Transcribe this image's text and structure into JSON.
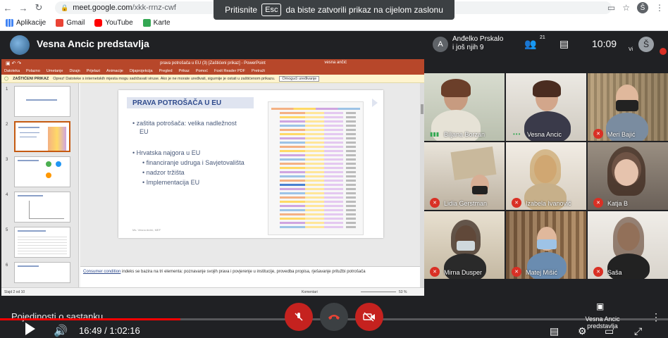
{
  "browser": {
    "url_host": "meet.google.com",
    "url_path": "/xkk-rrnz-cwf",
    "profile_initial": "Š",
    "bookmarks": [
      {
        "label": "Aplikacije",
        "color": "#4285f4"
      },
      {
        "label": "Gmail",
        "color": "#ea4335"
      },
      {
        "label": "YouTube",
        "color": "#ff0000"
      },
      {
        "label": "Karte",
        "color": "#34a853"
      }
    ]
  },
  "toast": {
    "before": "Pritisnite",
    "key": "Esc",
    "after": "da biste zatvorili prikaz na cijelom zaslonu"
  },
  "meet": {
    "presenter_title": "Vesna Ancic predstavlja",
    "people_line1": "Anđelko Prskalo",
    "people_line2": "i još njih 9",
    "people_avatar": "A",
    "people_count": "21",
    "clock": "10:09",
    "self_label": "Vi",
    "self_initial": "Š"
  },
  "ppt": {
    "window_title": "prava potrošača u EU (3) [Zaštićeni prikaz] - PowerPoint",
    "user_name": "vesna ančić",
    "menu": [
      "Datoteka",
      "Polazno",
      "Umetanje",
      "Dizajn",
      "Prijelazi",
      "Animacije",
      "Dijaprojekcija",
      "Pregled",
      "Prikaz",
      "Pomoć",
      "Foxit Reader PDF",
      "Pretraži"
    ],
    "warning_label": "ZAŠTIĆENI PRIKAZ",
    "warning_text": "Oprez! Datoteke s internetskih mjesta mogu sadržavati viruse. Ako je ne morate uređivati, sigurnije je ostati u zaštićenom prikazu.",
    "warning_button": "Omogući uređivanje",
    "slide_numbers": [
      "1",
      "2",
      "3",
      "4",
      "5",
      "6"
    ],
    "slide": {
      "heading": "PRAVA POTROŠAČA U EU",
      "bullet1": "• zaštita potrošača: velika nadležnost",
      "bullet1b": "EU",
      "bullet2": "• Hrvatska najgora u EU",
      "sub1": "• financiranje udruga i Savjetovališta",
      "sub2": "• nadzor tržišta",
      "sub3": "• Implementacija EU",
      "footer": "Ms. Vesna Ančić, MEF"
    },
    "notes_link": "Consumer condition",
    "notes_text": " indeks se bazira na tri elementa: poznavanje svojih prava i povjerenje u institucije, provedba propisa, rješavanje pritužbi potrošača",
    "status_slide": "Slajd 2 od 10",
    "status_comments": "Komentari",
    "status_zoom": "53 %"
  },
  "participants": [
    {
      "name": "Biljana Borzan",
      "state": "speaking"
    },
    {
      "name": "Vesna Ancic",
      "state": "dots"
    },
    {
      "name": "Meri Bajić",
      "state": "muted"
    },
    {
      "name": "Lidia Gerstman",
      "state": "muted"
    },
    {
      "name": "Izabela Ivanović",
      "state": "muted"
    },
    {
      "name": "Katja B",
      "state": "muted"
    },
    {
      "name": "Mirna Dusper",
      "state": "muted"
    },
    {
      "name": "Matej Mišić",
      "state": "muted"
    },
    {
      "name": "Saša",
      "state": "muted"
    }
  ],
  "player": {
    "details": "Pojedinosti o sastanku",
    "current_time": "16:49",
    "separator": " / ",
    "total_time": "1:02:16",
    "progress_fraction": 0.27,
    "presenting_line1": "Vesna Ancic",
    "presenting_line2": "predstavlja"
  },
  "colors": {
    "meet_bg": "#202124",
    "ppt_accent": "#b7472a",
    "mute_red": "#d93025",
    "progress_red": "#ff0000",
    "slide_heading": "#2e4a8c"
  },
  "icons": {
    "back": "arrow-left-icon",
    "forward": "arrow-right-icon",
    "reload": "reload-icon",
    "people": "people-icon",
    "chat": "chat-icon",
    "mic_off": "mic-off-icon",
    "hang_up": "phone-hangup-icon",
    "camera_off": "camera-off-icon",
    "present": "present-screen-icon"
  }
}
